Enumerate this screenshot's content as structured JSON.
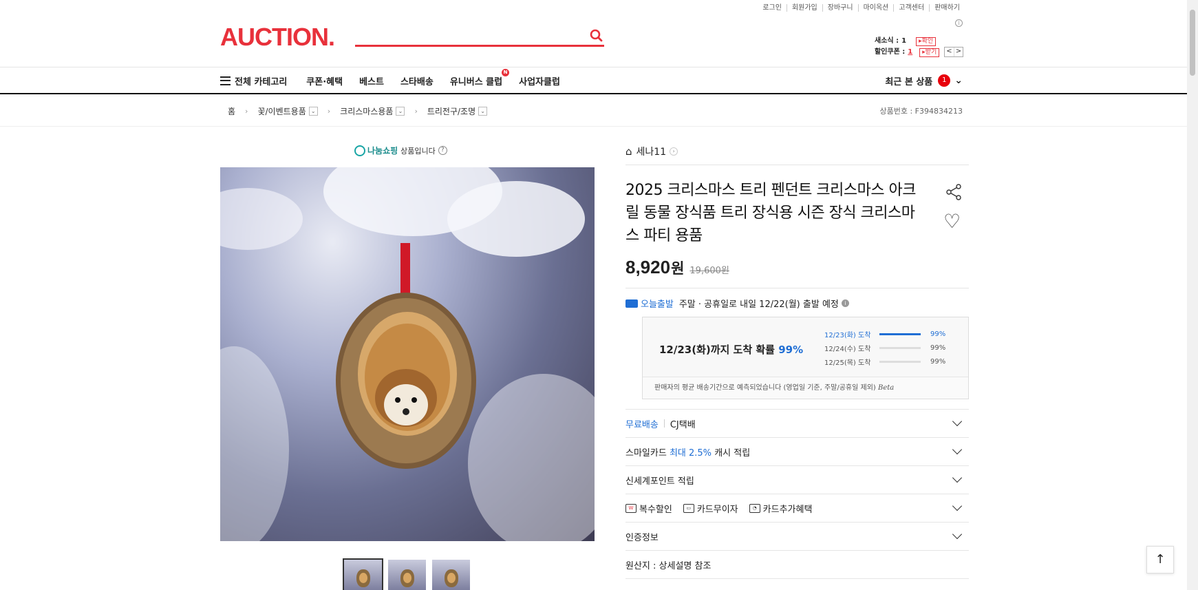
{
  "util_links": [
    "로그인",
    "회원가입",
    "장바구니",
    "마이옥션",
    "고객센터",
    "판매하기"
  ],
  "util_info": "i",
  "logo": "AUCTION.",
  "search": {
    "placeholder": "",
    "value": ""
  },
  "mini": {
    "news_label": "새소식 :",
    "news_count": "1",
    "news_btn": "▸확인",
    "coupon_label": "할인쿠폰 :",
    "coupon_count": "1",
    "coupon_btn": "▸받기",
    "prev": "<",
    "next": ">"
  },
  "gnb": {
    "all": "전체 카테고리",
    "menus": [
      "쿠폰·혜택",
      "베스트",
      "스타배송",
      "유니버스 클럽",
      "사업자클럽"
    ],
    "new_badge": "N",
    "recent": "최근 본 상품",
    "recent_count": "1"
  },
  "breadcrumb": {
    "home": "홈",
    "levels": [
      "꽃/이벤트용품",
      "크리스마스용품",
      "트리전구/조명"
    ],
    "product_no": "상품번호 : F394834213"
  },
  "nanum": {
    "logo": "나눔쇼핑",
    "text": "상품입니다",
    "help": "?"
  },
  "product": {
    "store": "세나11",
    "title": "2025 크리스마스 트리 펜던트 크리스마스 아크릴 동물 장식품 트리 장식용 시즌 장식 크리스마스 파티 용품",
    "price": "8,920",
    "won": "원",
    "old_price": "19,600원"
  },
  "shipping": {
    "today_label": "오늘출발",
    "notice": "주말 · 공휴일로 내일 12/22(월) 출발 예정",
    "info": "i",
    "headline_pre": "12/23(화)까지 도착 확률",
    "headline_pct": "99%",
    "predictions": [
      {
        "date": "12/23(화) 도착",
        "pct": "99%",
        "fill": 1.0
      },
      {
        "date": "12/24(수) 도착",
        "pct": "99%",
        "fill": 0
      },
      {
        "date": "12/25(목) 도착",
        "pct": "99%",
        "fill": 0
      }
    ],
    "foot_text": "판매자의 평균 배송기간으로 예측되었습니다 (영업일 기준, 주말/공휴일 제외)",
    "foot_beta": "Beta"
  },
  "accordion": {
    "free_ship": "무료배송",
    "carrier": "CJ택배",
    "smile_pre": "스마일카드",
    "smile_hl": "최대 2.5%",
    "smile_post": "캐시 적립",
    "shinsegae": "신세계포인트 적립",
    "multi_discount": "복수할인",
    "card_noint": "카드무이자",
    "card_extra": "카드추가혜택",
    "cert": "인증정보",
    "origin": "원산지 : 상세설명 참조"
  },
  "top_button": "↑",
  "colors": {
    "brand": "#e8313b",
    "blue": "#1f6ed4"
  }
}
